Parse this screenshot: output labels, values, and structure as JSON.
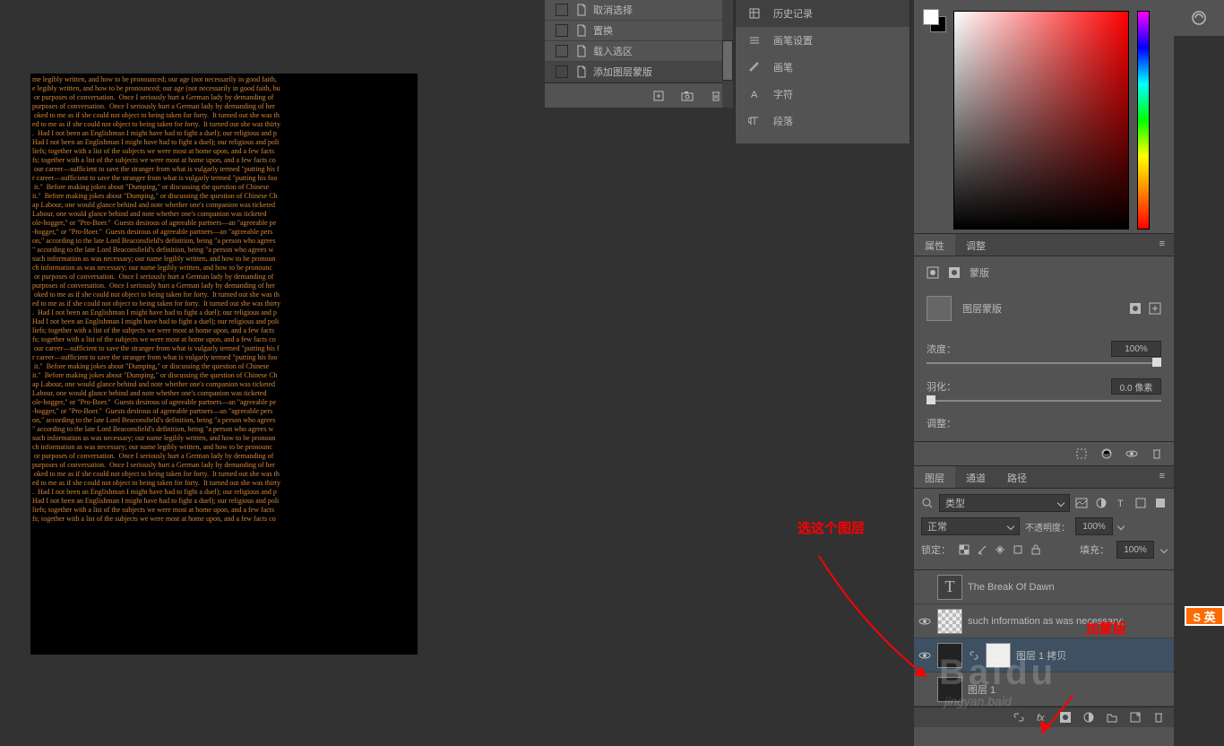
{
  "canvas_text": "me legibly written, and how to be pronounced; our age (not necessarily in good faith, \ne legibly written, and how to be pronounced; our age (not necessarily in good faith, bu\n or purposes of conversation.  Once I seriously hurt a German lady by demanding of\npurposes of conversation.  Once I seriously hurt a German lady by demanding of her\n oked to me as if she could not object to being taken for forty.  It turned out she was th\ned to me as if she could not object to being taken for forty.  It turned out she was thirty\n.  Had I not been an Englishman I might have had to fight a duel); our religious and p\nHad I not been an Englishman I might have had to fight a duel); our religious and poli\nliefs; together with a list of the subjects we were most at home upon, and a few facts\nfs; together with a list of the subjects we were most at home upon, and a few facts co\n our career—sufficient to save the stranger from what is vulgarly termed \"putting his f\nr career—sufficient to save the stranger from what is vulgarly termed \"putting his foo\n it.\"  Before making jokes about \"Dumping,\" or discussing the question of Chinese\nit.\"  Before making jokes about \"Dumping,\" or discussing the question of Chinese Ch\nap Labour, one would glance behind and note whether one's companion was ticketed\nLabour, one would glance behind and note whether one's companion was ticketed\nole-hogger,\" or \"Pro-Boer.\"  Guests desirous of agreeable partners—an \"agreeable pe\n-hogger,\" or \"Pro-Boer.\"  Guests desirous of agreeable partners—an \"agreeable pers\non,\" according to the late Lord Beaconsfield's definition, being \"a person who agrees\n\" according to the late Lord Beaconsfield's definition, being \"a person who agrees w\nsuch information as was necessary; our name legibly written, and how to be pronoun\nch information as was necessary; our name legibly written, and how to be pronounc\n or purposes of conversation.  Once I seriously hurt a German lady by demanding of\npurposes of conversation.  Once I seriously hurt a German lady by demanding of her\n oked to me as if she could not object to being taken for forty.  It turned out she was th\ned to me as if she could not object to being taken for forty.  It turned out she was thirty\n.  Had I not been an Englishman I might have had to fight a duel); our religious and p\nHad I not been an Englishman I might have had to fight a duel); our religious and poli\nliefs; together with a list of the subjects we were most at home upon, and a few facts\nfs; together with a list of the subjects we were most at home upon, and a few facts co\n our career—sufficient to save the stranger from what is vulgarly termed \"putting his f\nr career—sufficient to save the stranger from what is vulgarly termed \"putting his foo\n it.\"  Before making jokes about \"Dumping,\" or discussing the question of Chinese\nit.\"  Before making jokes about \"Dumping,\" or discussing the question of Chinese Ch\nap Labour, one would glance behind and note whether one's companion was ticketed\nLabour, one would glance behind and note whether one's companion was ticketed\nole-hogger,\" or \"Pro-Boer.\"  Guests desirous of agreeable partners—an \"agreeable pe\n-hogger,\" or \"Pro-Boer.\"  Guests desirous of agreeable partners—an \"agreeable pers\non,\" according to the late Lord Beaconsfield's definition, being \"a person who agrees\n\" according to the late Lord Beaconsfield's definition, being \"a person who agrees w\nsuch information as was necessary; our name legibly written, and how to be pronoun\nch information as was necessary; our name legibly written, and how to be pronounc\n or purposes of conversation.  Once I seriously hurt a German lady by demanding of\npurposes of conversation.  Once I seriously hurt a German lady by demanding of her\n oked to me as if she could not object to being taken for forty.  It turned out she was th\ned to me as if she could not object to being taken for forty.  It turned out she was thirty\n.  Had I not been an Englishman I might have had to fight a duel); our religious and p\nHad I not been an Englishman I might have had to fight a duel); our religious and poli\nliefs; together with a list of the subjects we were most at home upon, and a few facts\nfs; together with a list of the subjects we were most at home upon, and a few facts co",
  "history": {
    "items": [
      "取消选择",
      "置换",
      "载入选区",
      "添加图层蒙版"
    ]
  },
  "strip": {
    "items": [
      "历史记录",
      "画笔设置",
      "画笔",
      "字符",
      "段落"
    ]
  },
  "props": {
    "tab1": "属性",
    "tab2": "调整",
    "mask_label": "蒙版",
    "layer_mask": "图层蒙版",
    "density_label": "浓度：",
    "density_val": "100%",
    "feather_label": "羽化：",
    "feather_val": "0.0 像素",
    "refine_label": "调整："
  },
  "layers": {
    "tab1": "图层",
    "tab2": "通道",
    "tab3": "路径",
    "kind_label": "类型",
    "blend": "正常",
    "opacity_label": "不透明度：",
    "opacity_val": "100%",
    "lock_label": "锁定：",
    "fill_label": "填充：",
    "fill_val": "100%",
    "items": [
      {
        "name": "The Break Of  Dawn"
      },
      {
        "name": "such information as was necessary;"
      },
      {
        "name": "图层 1 拷贝"
      },
      {
        "name": "图层 1"
      }
    ]
  },
  "annotations": {
    "a1": "选这个图层",
    "a2": "加蒙版"
  },
  "watermark": "Baidu",
  "watermark2": "jingyan.baid",
  "ime": "S 英"
}
